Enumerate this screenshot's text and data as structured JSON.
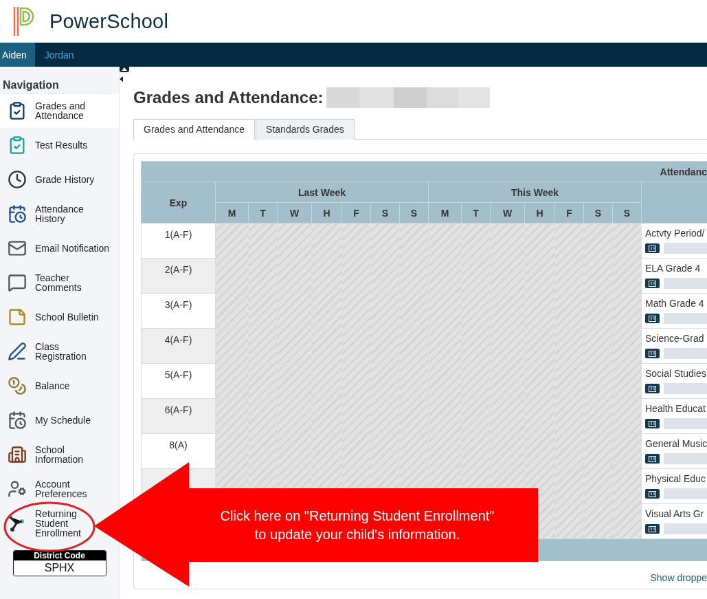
{
  "header": {
    "logo_text": "PowerSchool"
  },
  "students": [
    {
      "name": "Aiden",
      "selected": true
    },
    {
      "name": "Jordan",
      "selected": false
    }
  ],
  "sidebar": {
    "title": "Navigation",
    "items": [
      {
        "label": "Grades and Attendance",
        "selected": true
      },
      {
        "label": "Test Results",
        "selected": false
      },
      {
        "label": "Grade History",
        "selected": false
      },
      {
        "label": "Attendance History",
        "selected": false
      },
      {
        "label": "Email Notification",
        "selected": false
      },
      {
        "label": "Teacher Comments",
        "selected": false
      },
      {
        "label": "School Bulletin",
        "selected": false
      },
      {
        "label": "Class Registration",
        "selected": false
      },
      {
        "label": "Balance",
        "selected": false
      },
      {
        "label": "My Schedule",
        "selected": false
      },
      {
        "label": "School Information",
        "selected": false
      },
      {
        "label": "Account Preferences",
        "selected": false
      },
      {
        "label": "Returning Student Enrollment",
        "selected": false
      }
    ],
    "district_code": {
      "label": "District Code",
      "value": "SPHX"
    }
  },
  "page": {
    "title": "Grades and Attendance:",
    "tabs": [
      {
        "label": "Grades and Attendance",
        "selected": true
      },
      {
        "label": "Standards Grades",
        "selected": false
      }
    ],
    "table": {
      "group_header": "Attendanc",
      "exp_header": "Exp",
      "weeks": [
        {
          "label": "Last Week",
          "days": [
            "M",
            "T",
            "W",
            "H",
            "F",
            "S",
            "S"
          ]
        },
        {
          "label": "This Week",
          "days": [
            "M",
            "T",
            "W",
            "H",
            "F",
            "S",
            "S"
          ]
        }
      ],
      "rows": [
        {
          "exp": "1(A-F)",
          "course": "Actvty Period/"
        },
        {
          "exp": "2(A-F)",
          "course": "ELA Grade 4"
        },
        {
          "exp": "3(A-F)",
          "course": "Math Grade 4"
        },
        {
          "exp": "4(A-F)",
          "course": "Science-Grad"
        },
        {
          "exp": "5(A-F)",
          "course": "Social Studies"
        },
        {
          "exp": "6(A-F)",
          "course": "Health Educat"
        },
        {
          "exp": "8(A)",
          "course": "General Music"
        },
        {
          "course": "Physical Educ"
        },
        {
          "course": "Visual Arts Gr"
        }
      ]
    },
    "footer_link": "Show droppe"
  },
  "callout": {
    "lines": [
      "Click here on \"Returning Student Enrollment\"",
      "to update your child's information."
    ]
  }
}
